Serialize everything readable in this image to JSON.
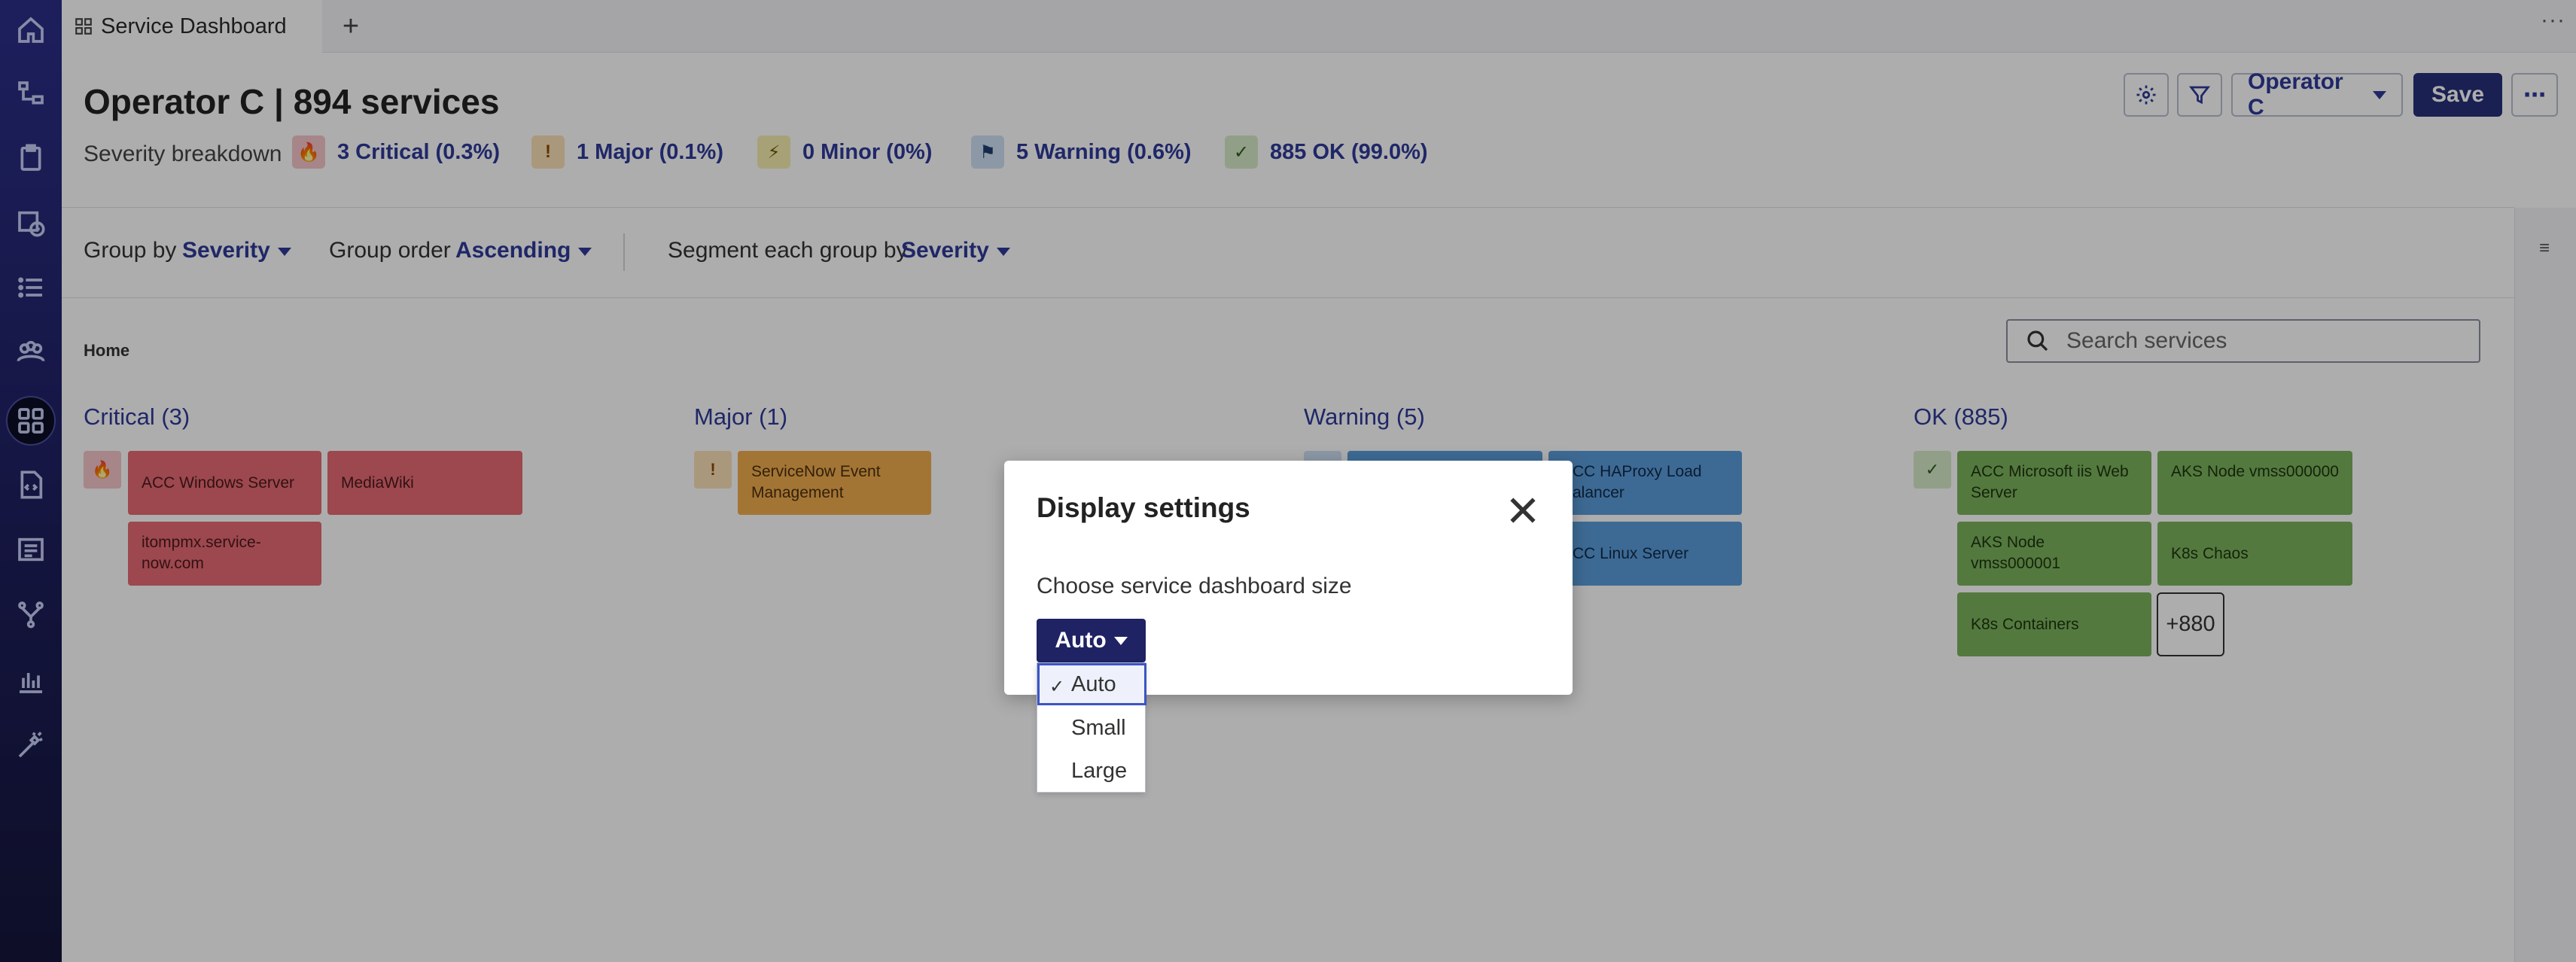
{
  "tab": {
    "title": "Service Dashboard",
    "add_label": "+",
    "more_label": "···"
  },
  "header": {
    "title": "Operator C | 894 services",
    "severity_label": "Severity breakdown",
    "severities": [
      {
        "label": "3 Critical (0.3%)",
        "icon": "fire-icon",
        "glyph": "🔥",
        "color": "#f5c6c9"
      },
      {
        "label": "1 Major (0.1%)",
        "icon": "exclamation-icon",
        "glyph": "!",
        "color": "#fbe0b8"
      },
      {
        "label": "0 Minor (0%)",
        "icon": "lightning-icon",
        "glyph": "⚡",
        "color": "#f7eeb0"
      },
      {
        "label": "5 Warning (0.6%)",
        "icon": "flag-icon",
        "glyph": "⚑",
        "color": "#cfe1f5"
      },
      {
        "label": "885 OK (99.0%)",
        "icon": "check-icon",
        "glyph": "✓",
        "color": "#d6ebc9"
      }
    ],
    "operator_label": "Operator C",
    "save_label": "Save"
  },
  "groupbar": {
    "group_by_label": "Group by",
    "group_by_value": "Severity",
    "group_order_label": "Group order",
    "group_order_value": "Ascending",
    "segment_label": "Segment each group by",
    "segment_value": "Severity"
  },
  "main": {
    "breadcrumb": "Home",
    "search_placeholder": "Search services",
    "groups": {
      "critical": {
        "title": "Critical (3)",
        "tiles": [
          "ACC Windows Server",
          "MediaWiki",
          "itompmx.service-now.com"
        ]
      },
      "major": {
        "title": "Major (1)",
        "tiles": [
          "ServiceNow Event Management"
        ]
      },
      "warning": {
        "title": "Warning (5)",
        "tiles": [
          "ACC HAProxy Load Balancer",
          "ACC Linux Server"
        ]
      },
      "ok": {
        "title": "OK (885)",
        "tiles": [
          "ACC Microsoft iis Web Server",
          "AKS Node vmss000000",
          "AKS Node vmss000001",
          "K8s Chaos",
          "K8s Containers"
        ],
        "more": "+880"
      }
    }
  },
  "dialog": {
    "title": "Display settings",
    "label": "Choose service dashboard size",
    "selected": "Auto",
    "options": [
      "Auto",
      "Small",
      "Large"
    ]
  }
}
